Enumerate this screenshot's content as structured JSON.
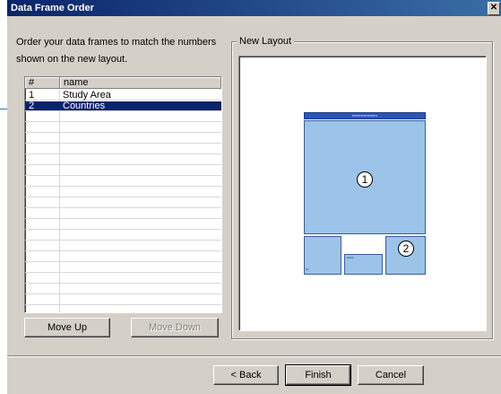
{
  "dialog": {
    "title": "Data Frame Order",
    "instructions": "Order your data frames to match the numbers shown on the new layout.",
    "list": {
      "columns": [
        "#",
        "name"
      ],
      "rows": [
        {
          "num": "1",
          "name": "Study Area"
        },
        {
          "num": "2",
          "name": "Countries"
        }
      ],
      "selected_row": "2"
    },
    "buttons": {
      "move_up": "Move Up",
      "move_down": "Move Down",
      "back": "< Back",
      "finish": "Finish",
      "cancel": "Cancel"
    },
    "preview_group_label": "New Layout",
    "preview": {
      "frame1_number": "1",
      "frame2_number": "2"
    }
  },
  "colors": {
    "titlebar": "#0a246a",
    "selection": "#0a246a",
    "callout": "#1f6fd0",
    "frame_fill": "#9cc3e8"
  }
}
